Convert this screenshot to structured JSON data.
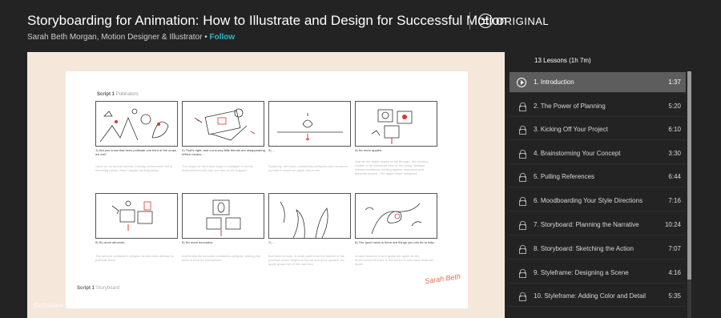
{
  "header": {
    "title": "Storyboarding for Animation: How to Illustrate and Design for Successful Motion",
    "author": "Sarah Beth Morgan, Motion Designer & Illustrator",
    "separator": " • ",
    "follow": "Follow",
    "badge": "ORIGINAL"
  },
  "video": {
    "sheet_title": "Script 1",
    "sheet_subtitle": "Pollinators",
    "footer_title": "Script 1",
    "footer_subtitle": "Storyboard",
    "stamp": "Sarah Beth",
    "watermark": "Skillshare Original Course Video",
    "panels": [
      {
        "caption": "1) Did you know that bees pollinate one third of the crops we eat?",
        "note": "Open on an almost surreal, thriving environment full of blooming plants. Bees happily working away."
      },
      {
        "caption": "2) That's right, and our buzzy little friends are disappearing. Which means...",
        "note": "The edges of the frame begin to collapse in on the environment until only one bee is left, trapped."
      },
      {
        "caption": "3) ...",
        "note": "Suddenly, the frame completely collapses and becomes a portal in which an apple drops into."
      },
      {
        "caption": "4) No more apples.",
        "note": "Just as the apple begins to fall through, the camera rotates to an overhead view of the portal. Multiple frames/containers holding apples, avocados and almonds appear. The apple frame collapses."
      },
      {
        "caption": "5) No more almonds.",
        "note": "The almond containers collapse as two bees attempt to pollinate them."
      },
      {
        "caption": "6) No more avocados.",
        "note": "And finally the avocado containers collapse, leaving the bees to fend for themselves."
      },
      {
        "caption": "7) ...",
        "note": "But there is hope. A small plant from the bottom of the previous frame begins to sprout and grow upward. An apple grows out of the new tree."
      },
      {
        "caption": "8) The good news is there are things you can do to help.",
        "note": "A hand reaches in and grabs the apple as the environment blooms. A few bucks in one hand close the apple."
      }
    ]
  },
  "lessons": {
    "header": "13 Lessons (1h 7m)",
    "items": [
      {
        "label": "1. Introduction",
        "duration": "1:37",
        "active": true
      },
      {
        "label": "2. The Power of Planning",
        "duration": "5:20",
        "active": false
      },
      {
        "label": "3. Kicking Off Your Project",
        "duration": "6:10",
        "active": false
      },
      {
        "label": "4. Brainstorming Your Concept",
        "duration": "3:30",
        "active": false
      },
      {
        "label": "5. Pulling References",
        "duration": "6:44",
        "active": false
      },
      {
        "label": "6. Moodboarding Your Style Directions",
        "duration": "7:16",
        "active": false
      },
      {
        "label": "7. Storyboard: Planning the Narrative",
        "duration": "10:24",
        "active": false
      },
      {
        "label": "8. Storyboard: Sketching the Action",
        "duration": "7:07",
        "active": false
      },
      {
        "label": "9. Styleframe: Designing a Scene",
        "duration": "4:16",
        "active": false
      },
      {
        "label": "10. Styleframe: Adding Color and Detail",
        "duration": "5:35",
        "active": false
      }
    ]
  },
  "colors": {
    "background": "#232323",
    "accent": "#2fb5c8",
    "active_row": "#5d5d5d",
    "video_bg": "#f6e7db",
    "stamp": "#e36e4f"
  },
  "icons": {
    "active_lesson": "play-circle-icon",
    "locked_lesson": "lock-icon",
    "badge": "skillshare-original-icon"
  }
}
